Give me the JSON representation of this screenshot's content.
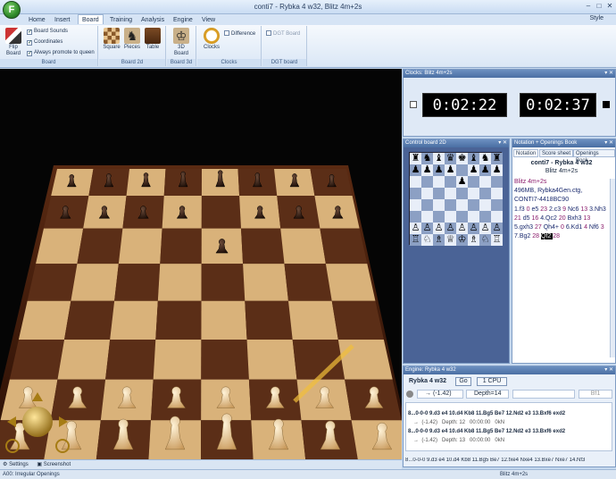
{
  "window": {
    "title": "conti7 - Rybka 4 w32, Blitz 4m+2s"
  },
  "menu_tabs": [
    "Home",
    "Insert",
    "Board",
    "Training",
    "Analysis",
    "Engine",
    "View"
  ],
  "active_tab": "Board",
  "style_label": "Style",
  "ribbon": {
    "flip_board": "Flip Board",
    "board_sounds": "Board Sounds",
    "coordinates": "Coordinates",
    "always_promote": "Always promote to queen",
    "group_board": "Board",
    "square": "Square",
    "pieces": "Pieces",
    "table": "Table",
    "group_board2d": "Board 2d",
    "board3d_btn": "3D Board",
    "group_board3d": "Board 3d",
    "clocks_btn": "Clocks",
    "difference": "Difference",
    "group_clocks": "Clocks",
    "dgt_board": "DGT Board",
    "group_dgt": "DGT board"
  },
  "clocks_panel": {
    "title": "Clocks: Blitz 4m+2s",
    "white_time": "0:02:22",
    "black_time": "0:02:37"
  },
  "control_board": {
    "title": "Control board 2D",
    "position": [
      "rnbqkbnr",
      "pppp.ppp",
      "....p...",
      "........",
      "........",
      "........",
      "PPPPPPPP",
      "RNBQKBNR"
    ]
  },
  "notation_panel": {
    "title": "Notation + Openings Book",
    "tabs": [
      "Notation",
      "Score sheet",
      "Openings Book"
    ],
    "game_title": "conti7 - Rybka 4 w32",
    "game_sub": "Blitz 4m+2s",
    "line1": "Blitz 4m+2s",
    "line2": "496MB, Rybka4Gen.ctg,",
    "line3": "CONTI7-4418BC90",
    "moves": [
      "1.f3",
      "0",
      "e5",
      "23",
      "2.c3",
      "9",
      "Nc6",
      "13",
      "3.Nh3",
      "21",
      "d5",
      "16",
      "4.Qc2",
      "20",
      "Bxh3",
      "13",
      "5.gxh3",
      "27",
      "Qh4+",
      "0",
      "6.Kd1",
      "4",
      "Nf6",
      "3",
      "7.Bg2",
      "28",
      "Qf2",
      "28"
    ]
  },
  "engine_panel": {
    "title": "Engine: Rybka 4 w32",
    "engine_name": "Rybka 4 w32",
    "go": "Go",
    "cpu": "1 CPU",
    "eval": "→  (-1.42)",
    "depth": "Depth=14",
    "bf": "Bf1",
    "line1": "8...0-0-0 9.d3 e4 10.d4 Kb8 11.Bg5 Be7 12.Nd2 e3 13.Bxf6 exd2",
    "line1_meta": "→  (-1.42)   Depth: 12   00:00:00   0kN",
    "line2": "8...0-0-0 9.d3 e4 10.d4 Kb8 11.Bg5 Be7 12.Nd2 e3 13.Bxf6 exd2",
    "line2_meta": "→  (-1.42)   Depth: 13   00:00:00   0kN",
    "bottom_line": "8...0-0-0 9.d3 e4 10.d4 Kb8 11.Bg5 Be7 12.fxe4 Nxe4 13.Bxe7 Nxe7 14.Nf3"
  },
  "bottom_bar": {
    "settings": "Settings",
    "screenshot": "Screenshot"
  },
  "status": {
    "opening": "A00: Irregular Openings",
    "right": "Blitz 4m+2s"
  }
}
